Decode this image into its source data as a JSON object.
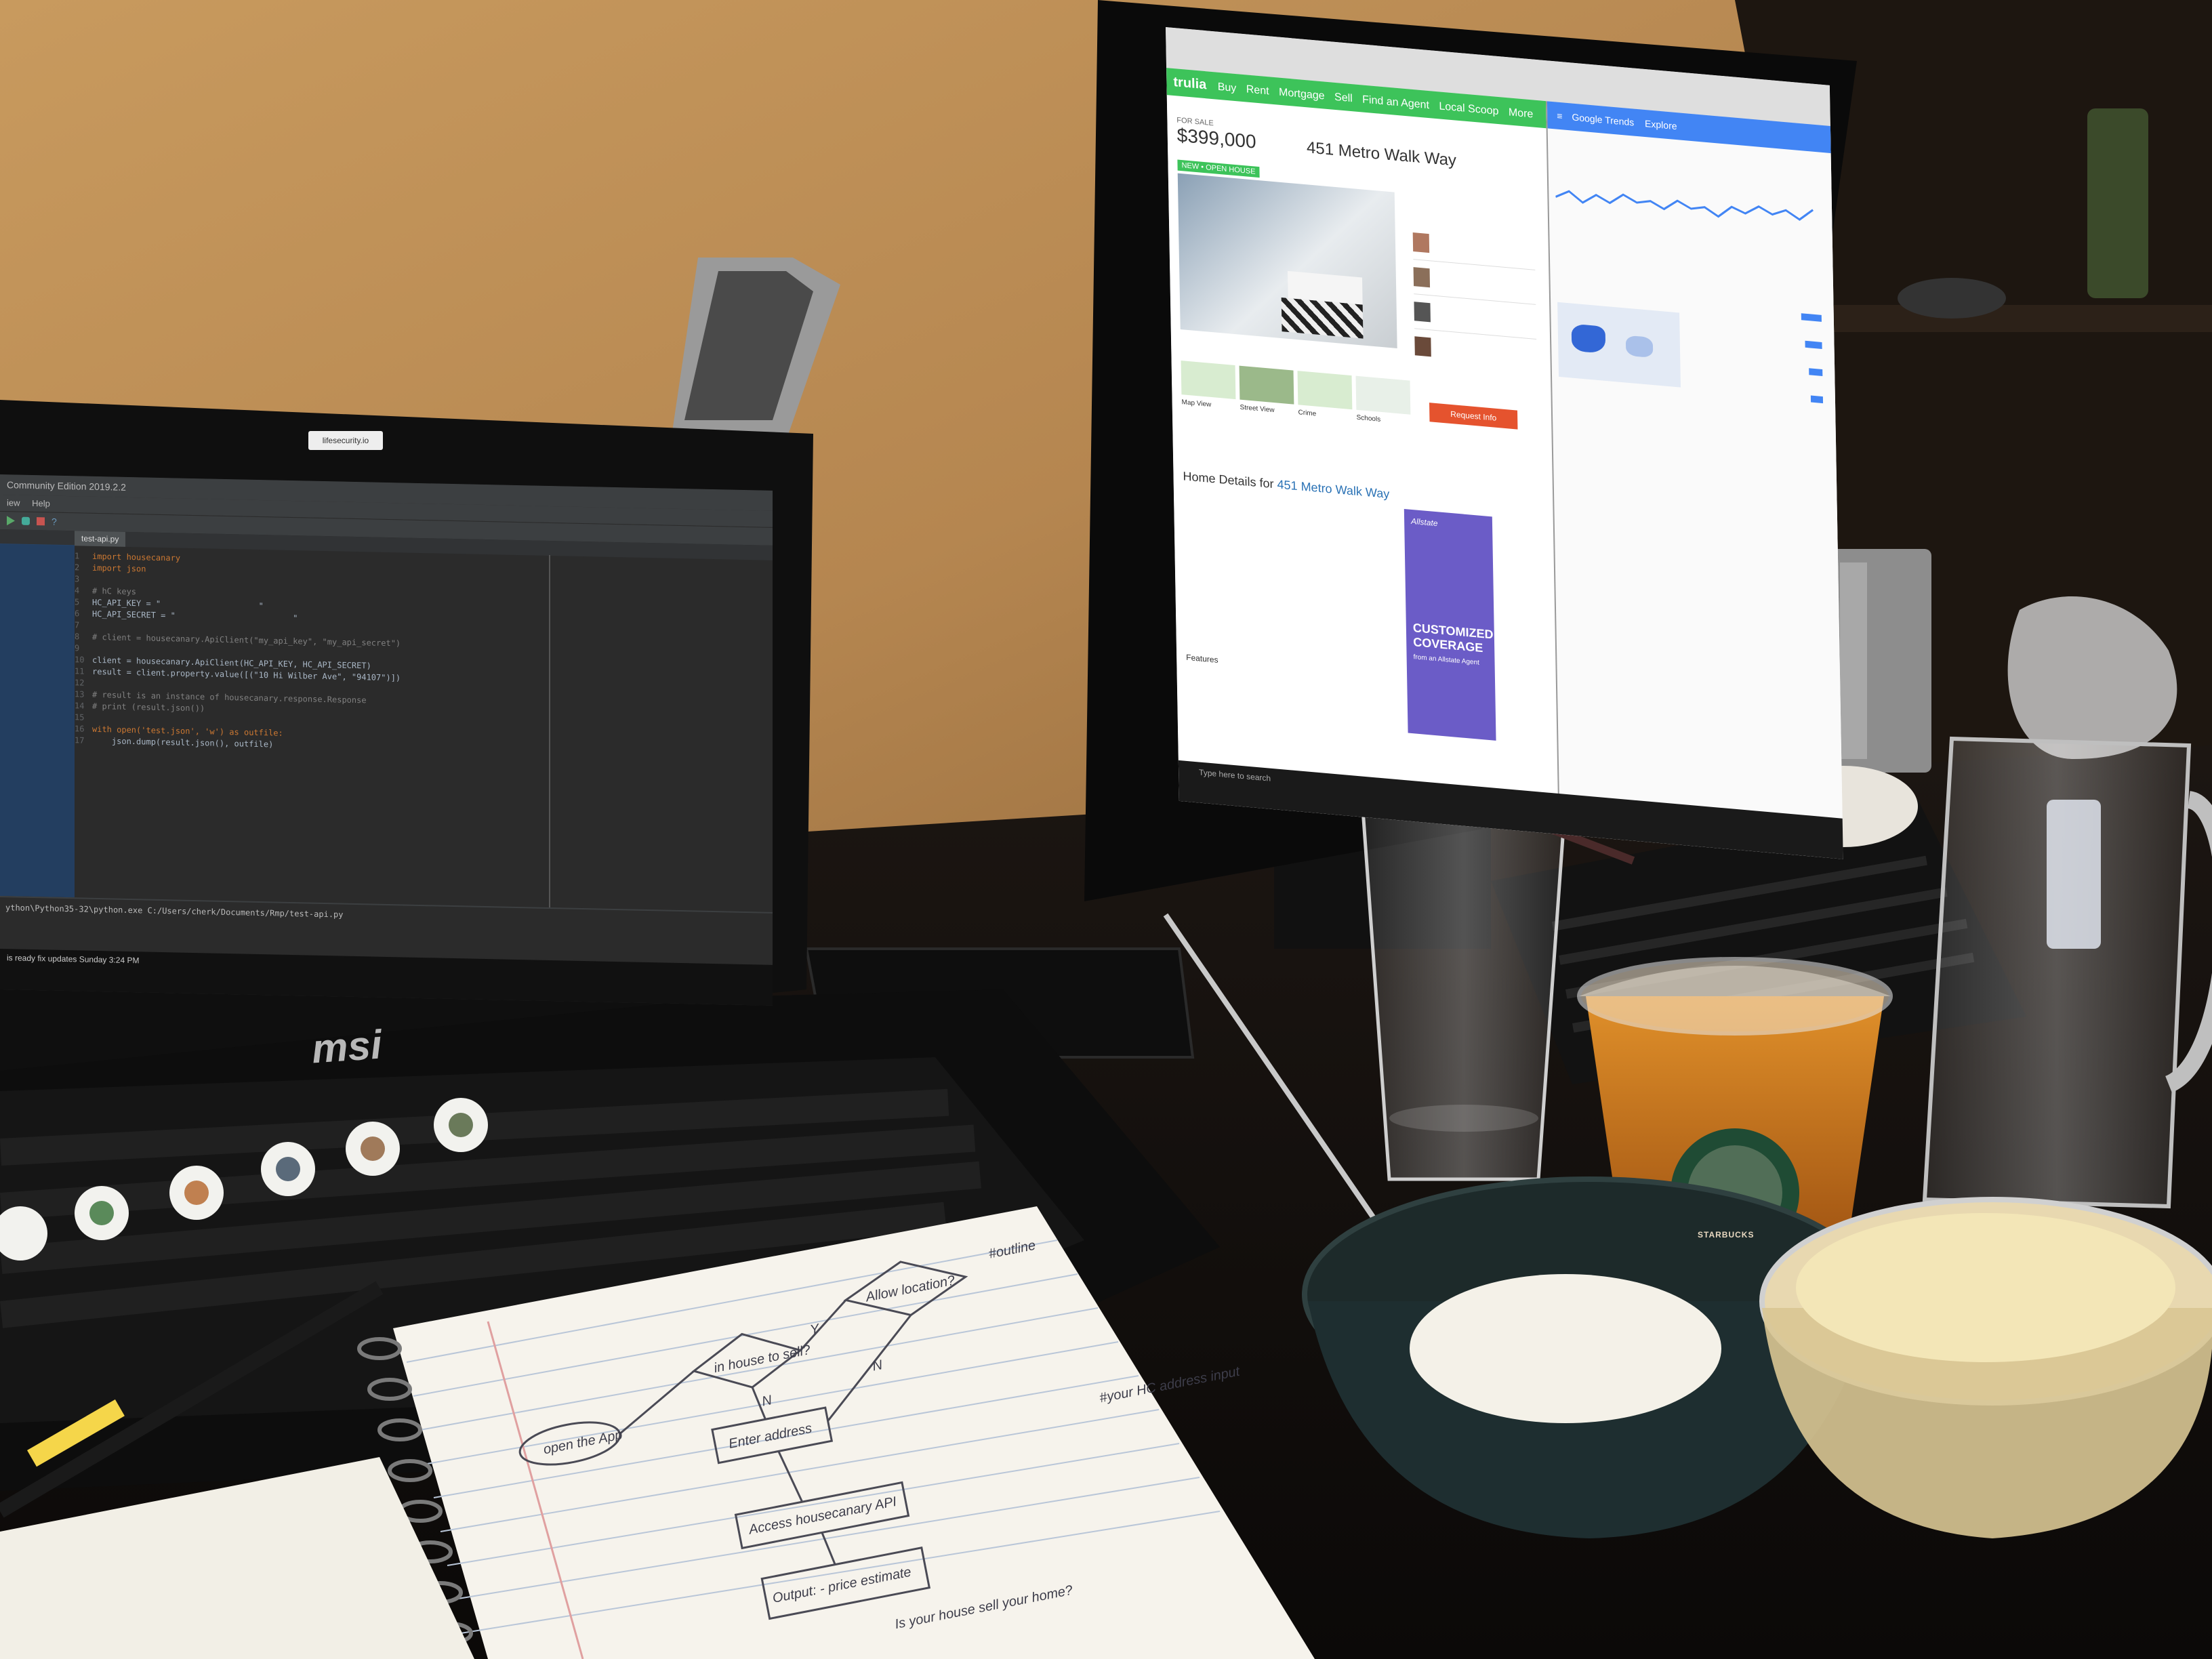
{
  "laptop": {
    "sticker_text": "lifesecurity.io",
    "brand": "msi",
    "ide": {
      "title": "Community Edition 2019.2.2",
      "menu": [
        "iew",
        "Help"
      ],
      "tab": "test-api.py",
      "code": [
        {
          "n": "1",
          "t": "import housecanary"
        },
        {
          "n": "2",
          "t": "import json"
        },
        {
          "n": "3",
          "t": ""
        },
        {
          "n": "4",
          "t": "# hC keys"
        },
        {
          "n": "5",
          "t": "HC_API_KEY = \"                    \""
        },
        {
          "n": "6",
          "t": "HC_API_SECRET = \"                        \""
        },
        {
          "n": "7",
          "t": ""
        },
        {
          "n": "8",
          "t": "# client = housecanary.ApiClient(\"my_api_key\", \"my_api_secret\")"
        },
        {
          "n": "9",
          "t": ""
        },
        {
          "n": "10",
          "t": "client = housecanary.ApiClient(HC_API_KEY, HC_API_SECRET)"
        },
        {
          "n": "11",
          "t": "result = client.property.value([(\"10 Hi Wilber Ave\", \"94107\")])"
        },
        {
          "n": "12",
          "t": ""
        },
        {
          "n": "13",
          "t": "# result is an instance of housecanary.response.Response"
        },
        {
          "n": "14",
          "t": "# print (result.json())"
        },
        {
          "n": "15",
          "t": ""
        },
        {
          "n": "16",
          "t": "with open('test.json', 'w') as outfile:"
        },
        {
          "n": "17",
          "t": "    json.dump(result.json(), outfile)"
        }
      ],
      "terminal": "ython\\Python35-32\\python.exe C:/Users/cherk/Documents/Rmp/test-api.py",
      "status": "is ready fix updates  Sunday 3:24 PM"
    }
  },
  "monitor": {
    "site": {
      "logo": "trulia",
      "nav": [
        "Buy",
        "Rent",
        "Mortgage",
        "Sell",
        "Find an Agent",
        "Local Scoop",
        "More"
      ],
      "price_label": "FOR SALE",
      "price": "$399,000",
      "address": "451 Metro Walk Way",
      "badge": "NEW • OPEN HOUSE",
      "details_heading_prefix": "Home Details for",
      "details_heading_address": "451 Metro Walk Way",
      "request_button": "Request Info",
      "ad_brand": "Allstate",
      "ad_line1": "CUSTOMIZED",
      "ad_line2": "COVERAGE",
      "ad_line3": "from an Allstate Agent",
      "features_label": "Features",
      "map_labels": [
        "Map View",
        "Street View",
        "Crime",
        "Schools"
      ]
    },
    "trends": {
      "logo": "Google Trends",
      "tab": "Explore"
    },
    "taskbar_search": "Type here to search"
  },
  "notebook": {
    "flowchart": [
      "open the App",
      "in house to sell?",
      "Allow location?",
      "Y",
      "N",
      "N",
      "Enter address",
      "Access housecanary API",
      "Output: - price estimate",
      "Is your house sell your home?"
    ],
    "notes": [
      "#outline",
      "#your HC address input"
    ]
  },
  "cup": {
    "brand": "STARBUCKS"
  },
  "colors": {
    "wall": "#b98a52",
    "trulia_green": "#3dc35a",
    "trends_blue": "#4285f4",
    "request_red": "#e5532e",
    "ad_purple": "#6b5cc7",
    "ide_bg": "#2b2b2b"
  }
}
